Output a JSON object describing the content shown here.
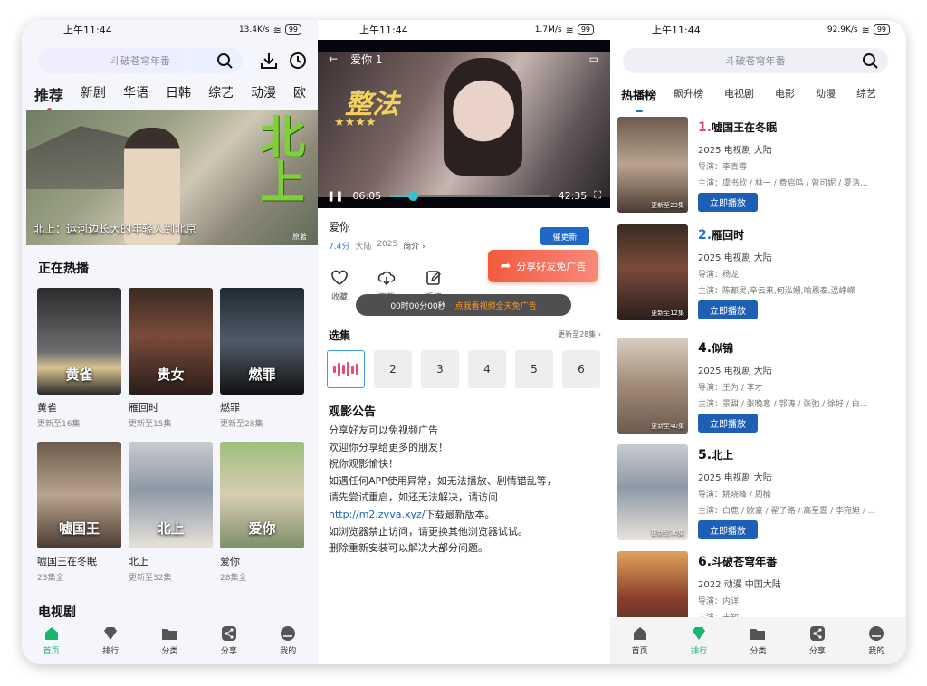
{
  "left": {
    "status": {
      "time": "上午11:44",
      "speed": "13.4K/s",
      "battery": "99"
    },
    "search_placeholder": "斗破苍穹年番",
    "tabs": [
      "推荐",
      "新剧",
      "华语",
      "日韩",
      "综艺",
      "动漫",
      "欧"
    ],
    "banner_caption": "北上：运河边长大的年轻人到北京",
    "banner_title_art": "北上",
    "banner_small": "原著",
    "section_now": "正在热播",
    "row1": [
      {
        "title": "黄雀",
        "sub": "更新至16集",
        "art": "黄雀"
      },
      {
        "title": "雁回时",
        "sub": "更新至15集",
        "art": "贵女"
      },
      {
        "title": "燃罪",
        "sub": "更新至28集",
        "art": "燃罪"
      }
    ],
    "row2": [
      {
        "title": "嘘国王在冬眠",
        "sub": "23集全",
        "art": "嘘国王"
      },
      {
        "title": "北上",
        "sub": "更新至32集",
        "art": "北上"
      },
      {
        "title": "爱你",
        "sub": "28集全",
        "art": "爱你"
      }
    ],
    "section_tv": "电视剧",
    "nav": [
      "首页",
      "排行",
      "分类",
      "分享",
      "我的"
    ]
  },
  "middle": {
    "status": {
      "time": "上午11:44",
      "speed": "1.7M/s",
      "battery": "99"
    },
    "player": {
      "title": "爱你 1",
      "current": "06:05",
      "total": "42:35",
      "progress": 0.144,
      "art": "整法"
    },
    "show_title": "爱你",
    "rating": "7.4分",
    "region": "大陆",
    "year": "2025",
    "intro_label": "简介 ›",
    "urge_label": "催更新",
    "actions": [
      "收藏",
      "下载",
      "反馈"
    ],
    "share_label": "分享好友免广告",
    "timer_text": "00时00分00秒",
    "timer_hint": "点我看视频全天免广告",
    "episodes_title": "选集",
    "episodes_update": "更新至28集 ›",
    "episodes": [
      "2",
      "3",
      "4",
      "5",
      "6"
    ],
    "notice_title": "观影公告",
    "notice_lines": [
      "分享好友可以免视频广告",
      "欢迎你分享给更多的朋友！",
      "祝你观影愉快！",
      "如遇任何APP使用异常，如无法播放、剧情错乱等，",
      "请先尝试重启，如还无法解决，请访问",
      "http://m2.zvva.xyz/",
      "下载最新版本。",
      "如浏览器禁止访问，请更换其他浏览器试试。",
      "删除重新安装可以解决大部分问题。"
    ]
  },
  "right": {
    "status": {
      "time": "上午11:44",
      "speed": "92.9K/s",
      "battery": "99"
    },
    "search_placeholder": "斗破苍穹年番",
    "tabs": [
      "热播榜",
      "飙升榜",
      "电视剧",
      "电影",
      "动漫",
      "综艺"
    ],
    "play_label": "立即播放",
    "items": [
      {
        "num": "1.",
        "name": "嘘国王在冬眠",
        "info": "2025  电视剧  大陆",
        "director": "导演：李青蓉",
        "cast": "主演：虞书欣 / 林一 / 费启鸣 / 曾可妮 / 夏浩...",
        "update": "更新至23集"
      },
      {
        "num": "2.",
        "name": "雁回时",
        "info": "2025  电视剧  大陆",
        "director": "导演：杨龙",
        "cast": "主演：陈都灵,辛云来,何泓姗,喻恩泰,温峥嵘",
        "update": "更新至12集"
      },
      {
        "num": "4.",
        "name": "似锦",
        "info": "2025  电视剧  大陆",
        "director": "导演：王为 / 李才",
        "cast": "主演：景甜 / 张晚意 / 郭涛 / 张弛 / 徐好 / 白...",
        "update": "更新至40集"
      },
      {
        "num": "5.",
        "name": "北上",
        "info": "2025  电视剧  大陆",
        "director": "导演：姚晓峰 / 周楠",
        "cast": "主演：白鹿 / 欧豪 / 翟子路 / 高至霆 / 李宛妲 / ...",
        "update": "更新至30集"
      },
      {
        "num": "6.",
        "name": "斗破苍穹年番",
        "info": "2022  动漫  中国大陆",
        "director": "导演：内详",
        "cast": "主演：未知",
        "update": ""
      }
    ],
    "nav": [
      "首页",
      "排行",
      "分类",
      "分享",
      "我的"
    ]
  },
  "colors": {
    "accent_blue": "#1d5fb5",
    "accent_green": "#18b56d",
    "accent_red": "#e04666",
    "share_orange": "#f35a3e"
  }
}
